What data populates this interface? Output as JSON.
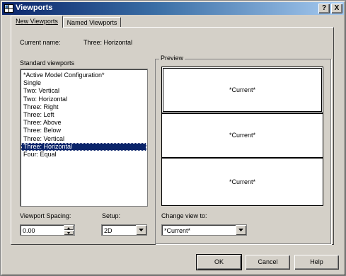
{
  "window": {
    "title": "Viewports",
    "help_btn": "?",
    "close_btn": "X"
  },
  "tabs": [
    {
      "label": "New Viewports",
      "active": true
    },
    {
      "label": "Named Viewports",
      "active": false
    }
  ],
  "current_name": {
    "label": "Current name:",
    "value": "Three: Horizontal"
  },
  "standard_viewports": {
    "label": "Standard viewports",
    "items": [
      "*Active Model Configuration*",
      "Single",
      "Two: Vertical",
      "Two: Horizontal",
      "Three: Right",
      "Three: Left",
      "Three: Above",
      "Three: Below",
      "Three: Vertical",
      "Three: Horizontal",
      "Four: Equal"
    ],
    "selected_index": 9
  },
  "preview": {
    "label": "Preview",
    "panes": [
      "*Current*",
      "*Current*",
      "*Current*"
    ]
  },
  "viewport_spacing": {
    "label": "Viewport Spacing:",
    "value": "0.00"
  },
  "setup": {
    "label": "Setup:",
    "value": "2D"
  },
  "change_view": {
    "label": "Change view to:",
    "value": "*Current*"
  },
  "buttons": {
    "ok": "OK",
    "cancel": "Cancel",
    "help": "Help"
  }
}
